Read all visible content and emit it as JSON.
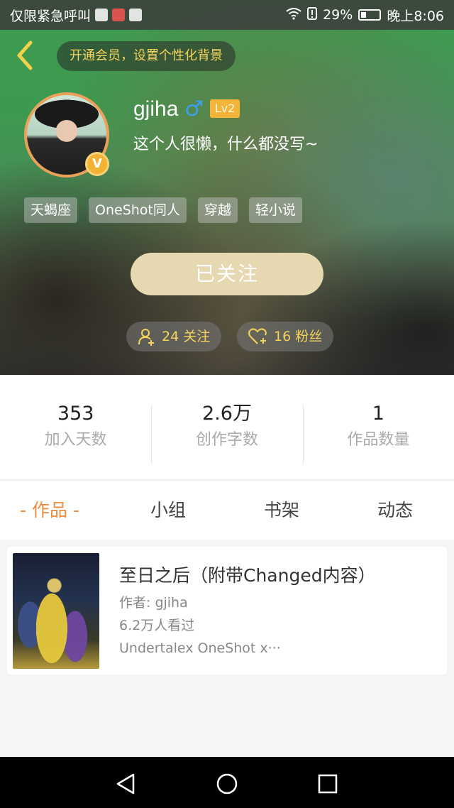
{
  "statusbar": {
    "left_text": "仅限紧急呼叫",
    "battery": "29%",
    "time": "晚上8:06"
  },
  "header": {
    "vip_promo": "开通会员，设置个性化背景",
    "username": "gjiha",
    "gender_symbol": "♂",
    "level": "Lv2",
    "verified_badge": "V",
    "bio": "这个人很懒，什么都没写~",
    "tags": [
      "天蝎座",
      "OneShot同人",
      "穿越",
      "轻小说"
    ],
    "follow_button": "已关注",
    "following": "24 关注",
    "fans": "16 粉丝"
  },
  "stats": [
    {
      "value": "353",
      "label": "加入天数"
    },
    {
      "value": "2.6万",
      "label": "创作字数"
    },
    {
      "value": "1",
      "label": "作品数量"
    }
  ],
  "tabs": {
    "works": "- 作品 -",
    "group": "小组",
    "shelf": "书架",
    "activity": "动态"
  },
  "works": [
    {
      "title": "至日之后（附带Changed内容）",
      "author": "作者: gjiha",
      "views": "6.2万人看过",
      "tags": "Undertalex OneShot x···"
    }
  ],
  "colors": {
    "accent": "#f08b3c",
    "gold": "#f4d45a",
    "level_badge": "#f3b43a",
    "follow_button": "#e6d8b0"
  },
  "icons": {
    "back": "chevron-left-icon",
    "gender": "male-icon",
    "following": "person-add-icon",
    "fans": "heart-add-icon",
    "nav": [
      "triangle-back-icon",
      "circle-home-icon",
      "square-recent-icon"
    ]
  }
}
